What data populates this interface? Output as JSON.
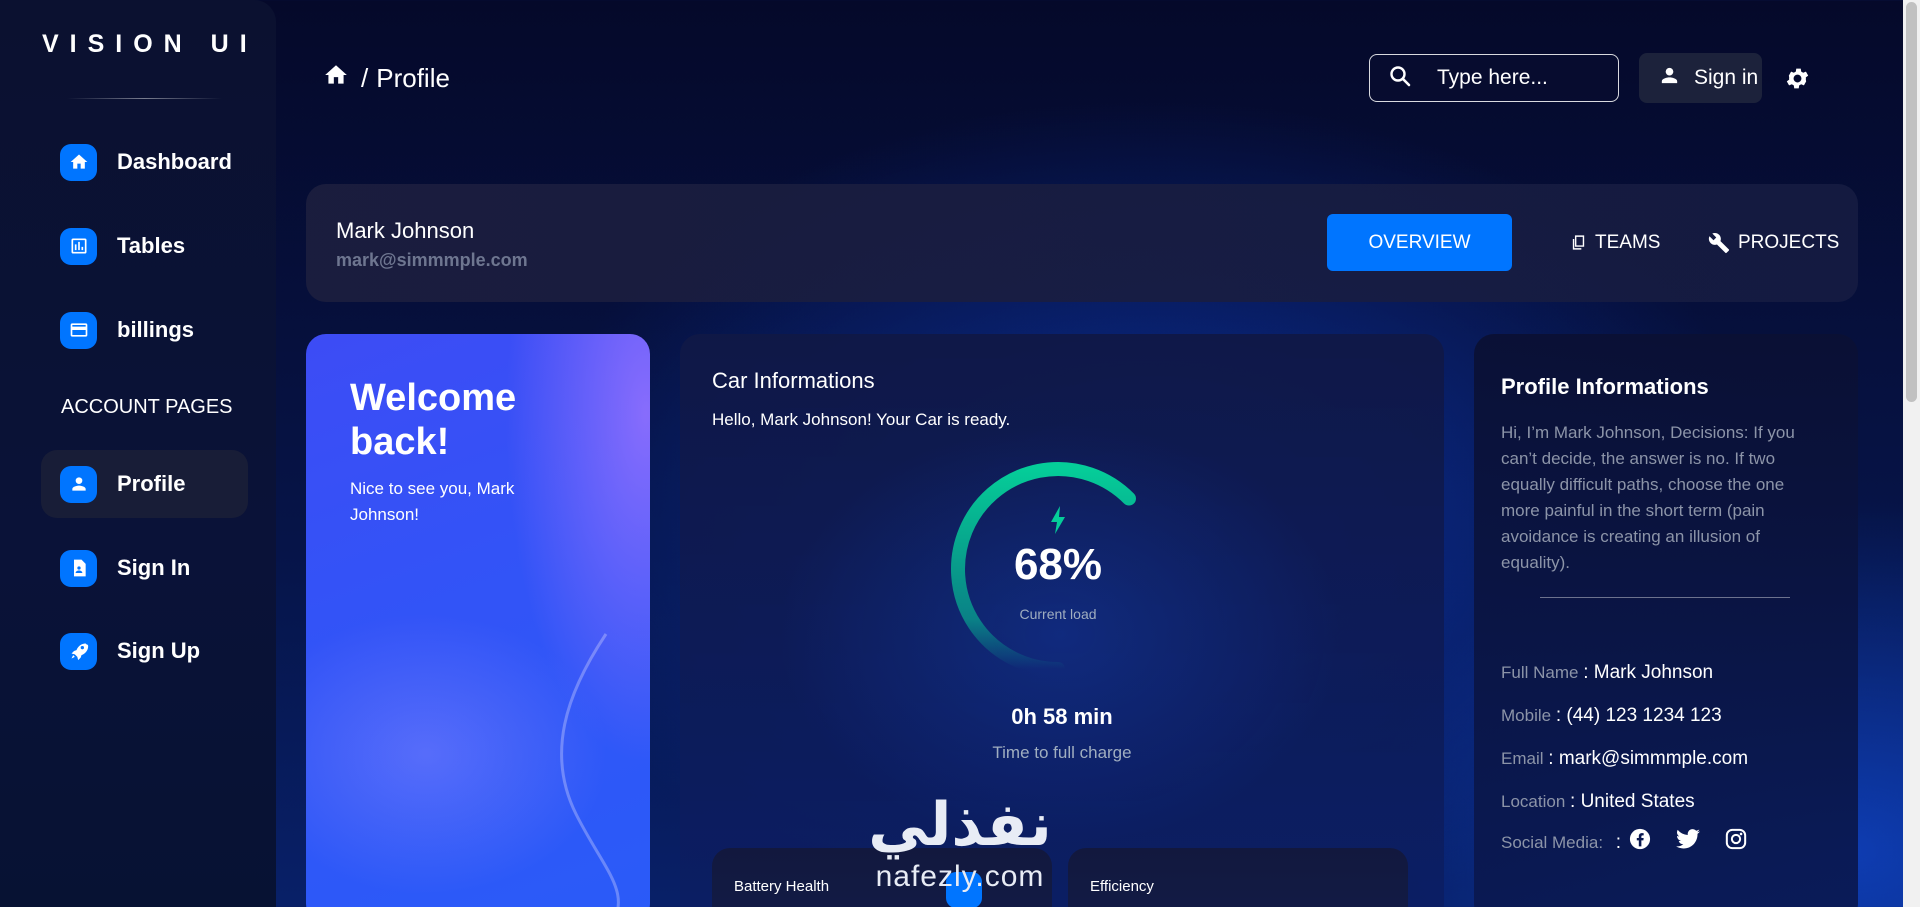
{
  "sidebar": {
    "brand": "VISION UI",
    "items": [
      {
        "label": "Dashboard",
        "icon": "home-icon"
      },
      {
        "label": "Tables",
        "icon": "chart-bar-icon"
      },
      {
        "label": "billings",
        "icon": "credit-card-icon"
      }
    ],
    "account_title": "ACCOUNT PAGES",
    "account_items": [
      {
        "label": "Profile",
        "icon": "person-icon",
        "active": true
      },
      {
        "label": "Sign In",
        "icon": "document-icon"
      },
      {
        "label": "Sign Up",
        "icon": "rocket-icon"
      }
    ]
  },
  "header": {
    "breadcrumb_sep": "/",
    "breadcrumb_page": "Profile",
    "search_placeholder": "Type here...",
    "signin_label": "Sign in"
  },
  "profile_bar": {
    "name": "Mark Johnson",
    "email": "mark@simmmple.com",
    "tabs": [
      {
        "label": "OVERVIEW",
        "active": true
      },
      {
        "label": "TEAMS",
        "icon": "copy-icon"
      },
      {
        "label": "PROJECTS",
        "icon": "wrench-icon"
      }
    ]
  },
  "welcome": {
    "title": "Welcome back!",
    "subtitle": "Nice to see you, Mark Johnson!"
  },
  "car": {
    "title": "Car Informations",
    "subtitle": "Hello, Mark Johnson! Your Car is ready.",
    "load_percent": "68%",
    "load_fraction": 0.68,
    "load_label": "Current load",
    "charge_time": "0h 58 min",
    "charge_label": "Time to full charge",
    "cards": [
      {
        "label": "Battery Health"
      },
      {
        "label": "Efficiency"
      }
    ]
  },
  "profile_info": {
    "title": "Profile Informations",
    "description": "Hi, I’m Mark Johnson, Decisions: If you can’t decide, the answer is no. If two equally difficult paths, choose the one more painful in the short term (pain avoidance is creating an illusion of equality).",
    "full_name_label": "Full Name",
    "full_name": "Mark Johnson",
    "mobile_label": "Mobile",
    "mobile": "(44) 123 1234 123",
    "email_label": "Email",
    "email": "mark@simmmple.com",
    "location_label": "Location",
    "location": "United States",
    "social_label": "Social Media:",
    "separator": ":"
  },
  "watermark": {
    "arabic": "نفذلي",
    "latin": "nafezly.com"
  },
  "colors": {
    "accent": "#0075ff",
    "gauge": "#05cd99",
    "muted": "#a0aec0"
  }
}
